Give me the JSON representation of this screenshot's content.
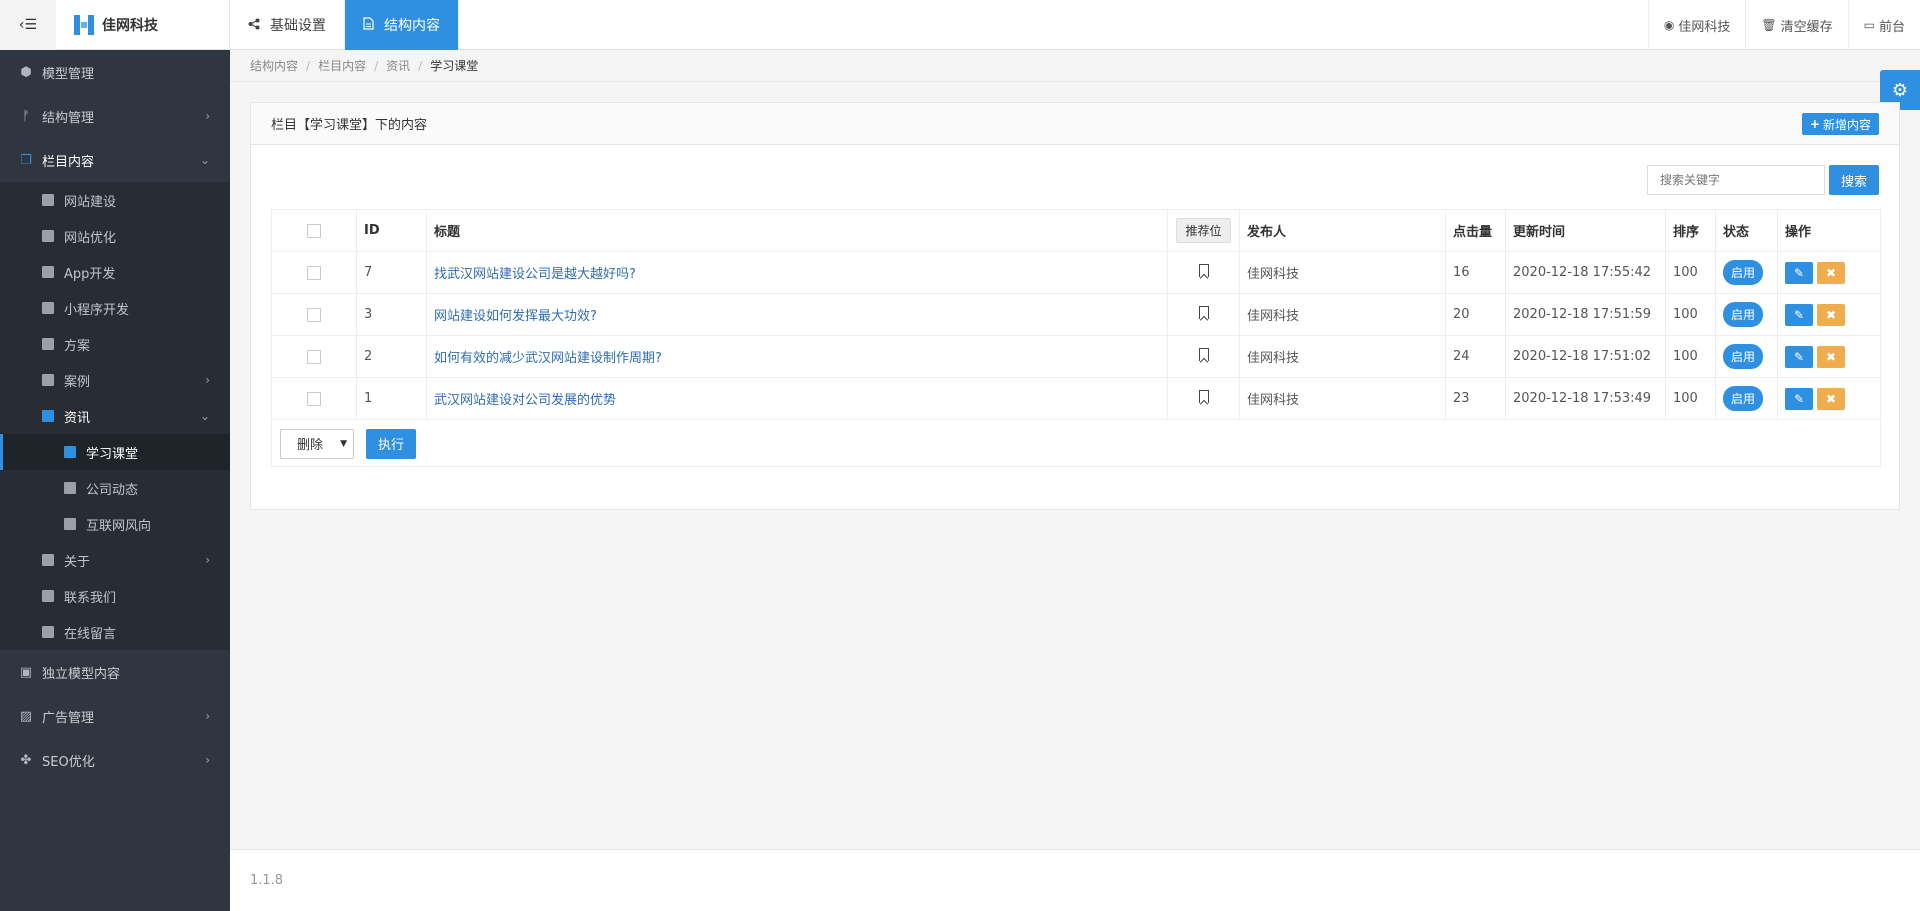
{
  "header": {
    "brand": "佳网科技",
    "tabs": [
      {
        "label": "基础设置",
        "icon": "share-icon"
      },
      {
        "label": "结构内容",
        "icon": "document-icon"
      }
    ],
    "right": [
      {
        "label": "佳网科技",
        "icon": "user-icon"
      },
      {
        "label": "清空缓存",
        "icon": "trash-icon"
      },
      {
        "label": "前台",
        "icon": "laptop-icon"
      }
    ]
  },
  "sidebar": {
    "model_mgmt": "模型管理",
    "struct_mgmt": "结构管理",
    "column_content": "栏目内容",
    "subs": {
      "s1": "网站建设",
      "s2": "网站优化",
      "s3": "App开发",
      "s4": "小程序开发",
      "s5": "方案",
      "s6": "案例",
      "s7": "资讯",
      "s7a": "学习课堂",
      "s7b": "公司动态",
      "s7c": "互联网风向",
      "s8": "关于",
      "s9": "联系我们",
      "s10": "在线留言"
    },
    "standalone": "独立模型内容",
    "ads": "广告管理",
    "seo": "SEO优化"
  },
  "breadcrumb": [
    "结构内容",
    "栏目内容",
    "资讯",
    "学习课堂"
  ],
  "panel": {
    "title": "栏目【学习课堂】下的内容",
    "add_label": "新增内容",
    "search_placeholder": "搜索关键字",
    "search_label": "搜索"
  },
  "table": {
    "headers": {
      "id": "ID",
      "title": "标题",
      "rec": "推荐位",
      "author": "发布人",
      "hits": "点击量",
      "updated": "更新时间",
      "sort": "排序",
      "status": "状态",
      "ops": "操作"
    },
    "rows": [
      {
        "id": "7",
        "title": "找武汉网站建设公司是越大越好吗?",
        "author": "佳网科技",
        "hits": "16",
        "updated": "2020-12-18 17:55:42",
        "sort": "100",
        "status": "启用"
      },
      {
        "id": "3",
        "title": "网站建设如何发挥最大功效?",
        "author": "佳网科技",
        "hits": "20",
        "updated": "2020-12-18 17:51:59",
        "sort": "100",
        "status": "启用"
      },
      {
        "id": "2",
        "title": "如何有效的减少武汉网站建设制作周期?",
        "author": "佳网科技",
        "hits": "24",
        "updated": "2020-12-18 17:51:02",
        "sort": "100",
        "status": "启用"
      },
      {
        "id": "1",
        "title": "武汉网站建设对公司发展的优势",
        "author": "佳网科技",
        "hits": "23",
        "updated": "2020-12-18 17:53:49",
        "sort": "100",
        "status": "启用"
      }
    ]
  },
  "batch": {
    "selected": "删除",
    "exec_label": "执行"
  },
  "footer": {
    "version": "1.1.8"
  }
}
